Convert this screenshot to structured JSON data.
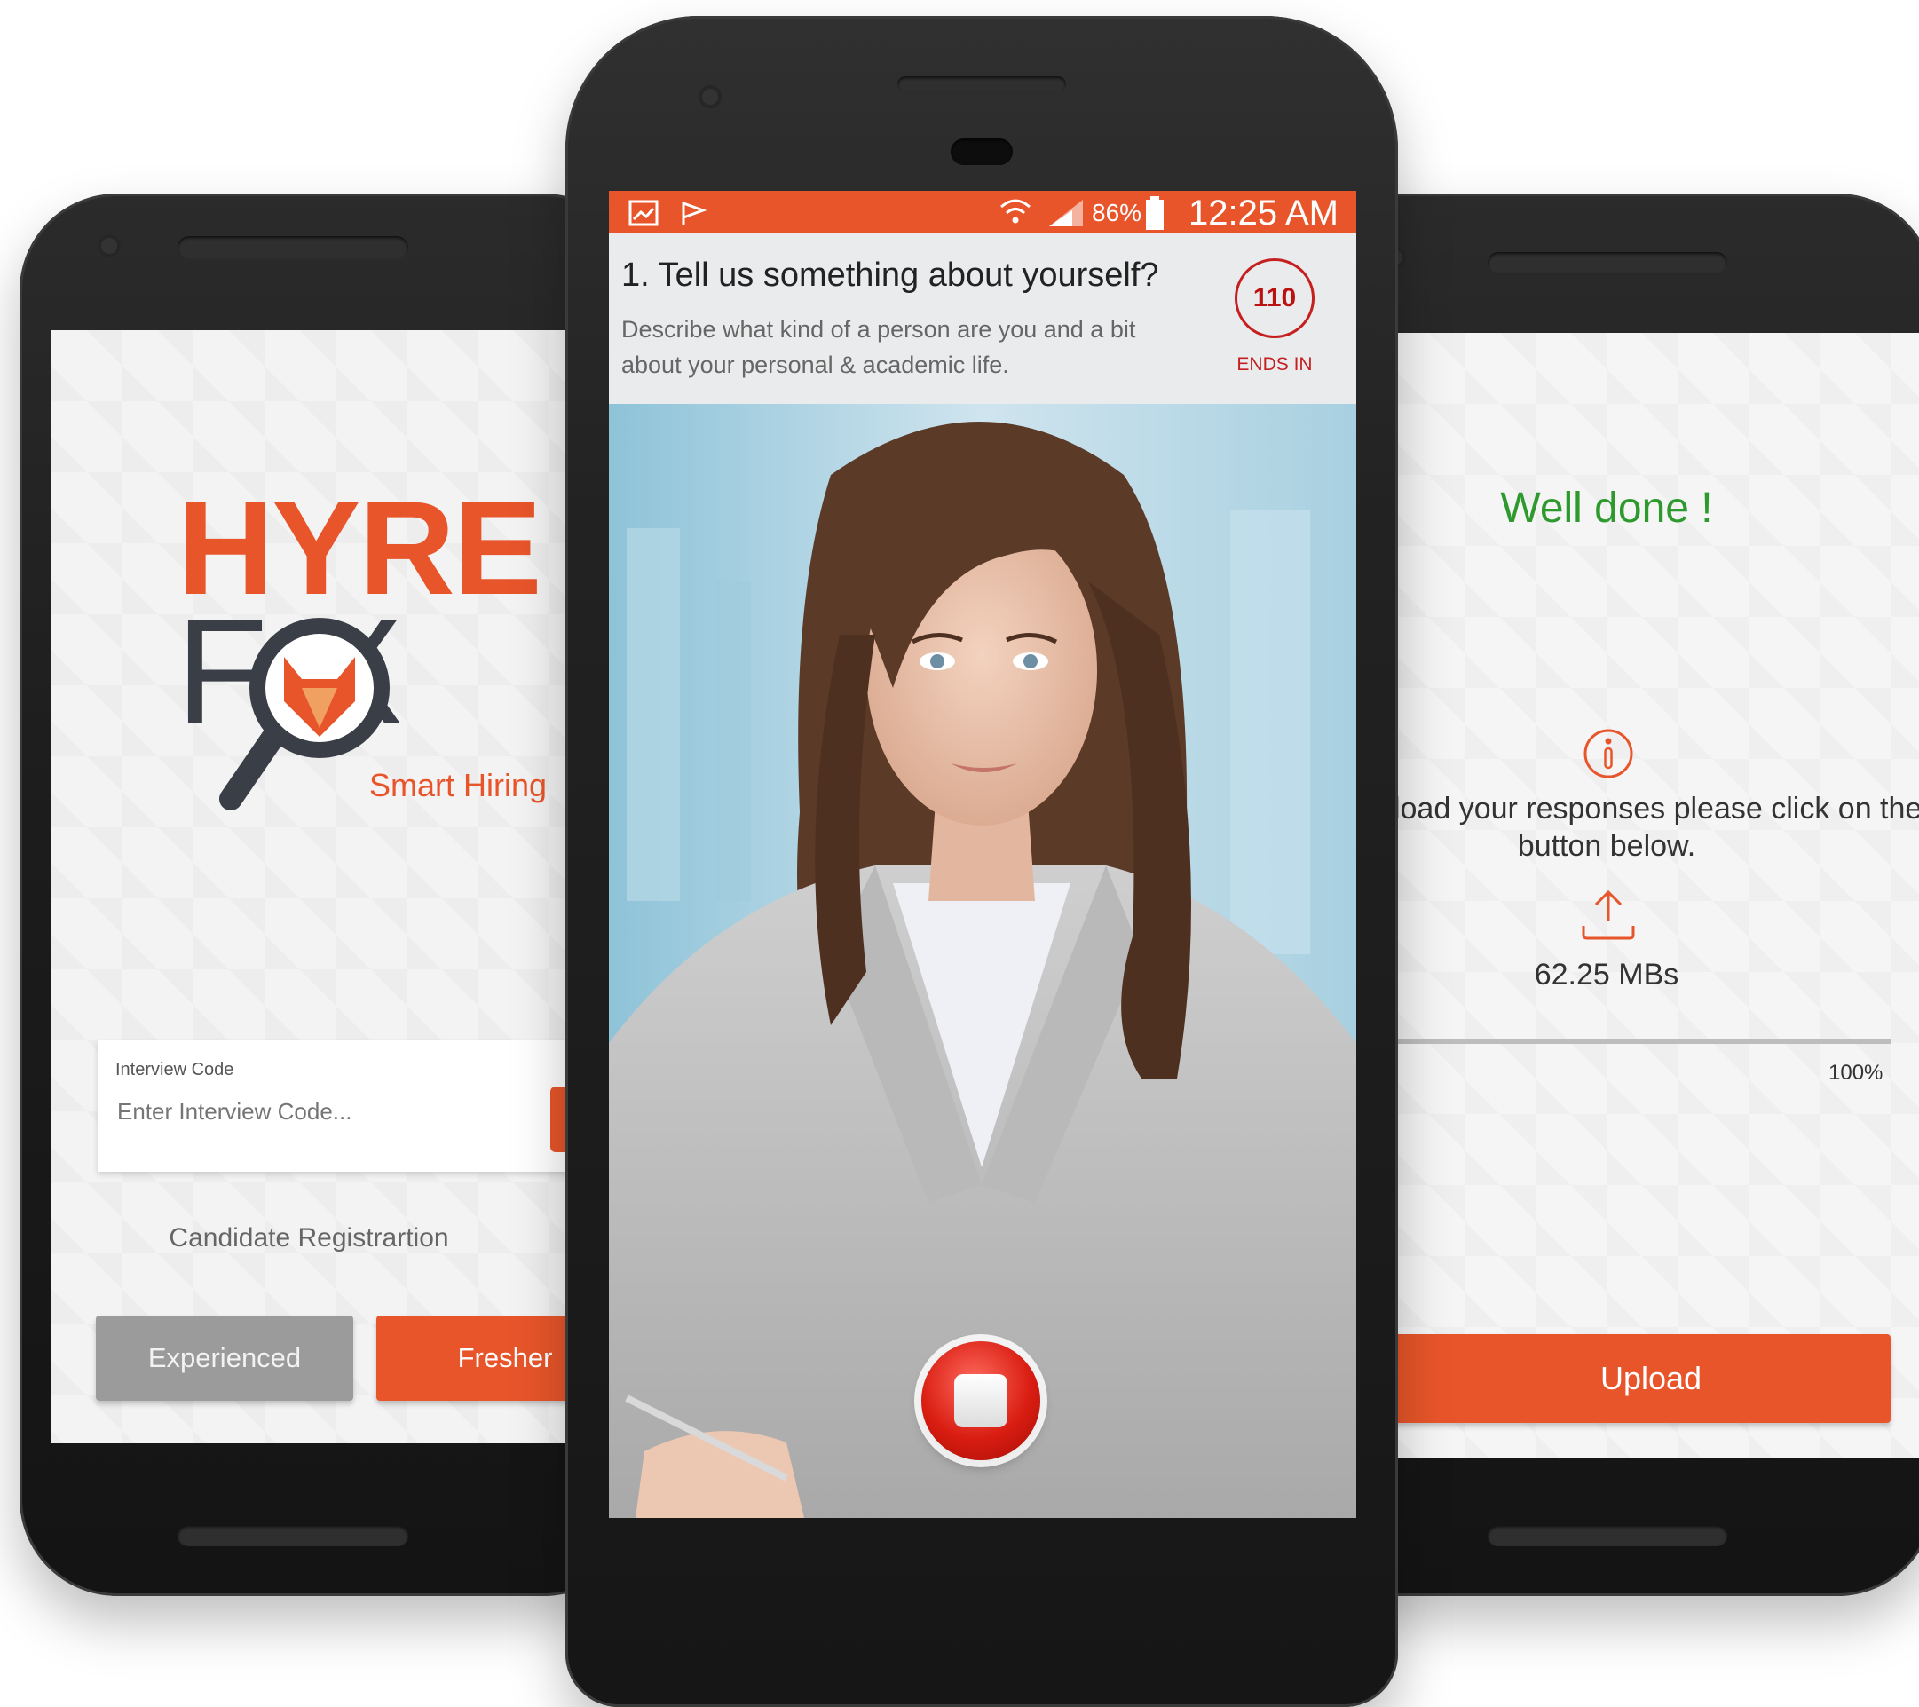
{
  "left_screen": {
    "logo_line1": "HYRE",
    "logo_line2": "F X",
    "logo_tagline": "Smart Hiring",
    "code_label": "Interview Code",
    "code_placeholder": "Enter Interview Code...",
    "registration_label": "Candidate Registrartion",
    "experienced_label": "Experienced",
    "fresher_label": "Fresher"
  },
  "center_screen": {
    "status_bar": {
      "battery": "86%",
      "time": "12:25 AM",
      "icons": [
        "gallery-icon",
        "flag-icon",
        "wifi-icon",
        "signal-icon",
        "battery-icon"
      ]
    },
    "question_title": "1. Tell us something about yourself?",
    "question_desc": "Describe what kind of a person are you and a bit about your personal & academic life.",
    "timer_value": "110",
    "timer_label": "ENDS IN"
  },
  "right_screen": {
    "title": "Well done !",
    "message": "er to upload your responses please click on the button below.",
    "size": "62.25 MBs",
    "progress_pct": "100%",
    "progress_value": 1.0,
    "upload_label": "Upload"
  },
  "colors": {
    "accent": "#e8552a",
    "success": "#2e9a2e",
    "timer": "#c61f1f",
    "logo_dark": "#3a3f47"
  }
}
